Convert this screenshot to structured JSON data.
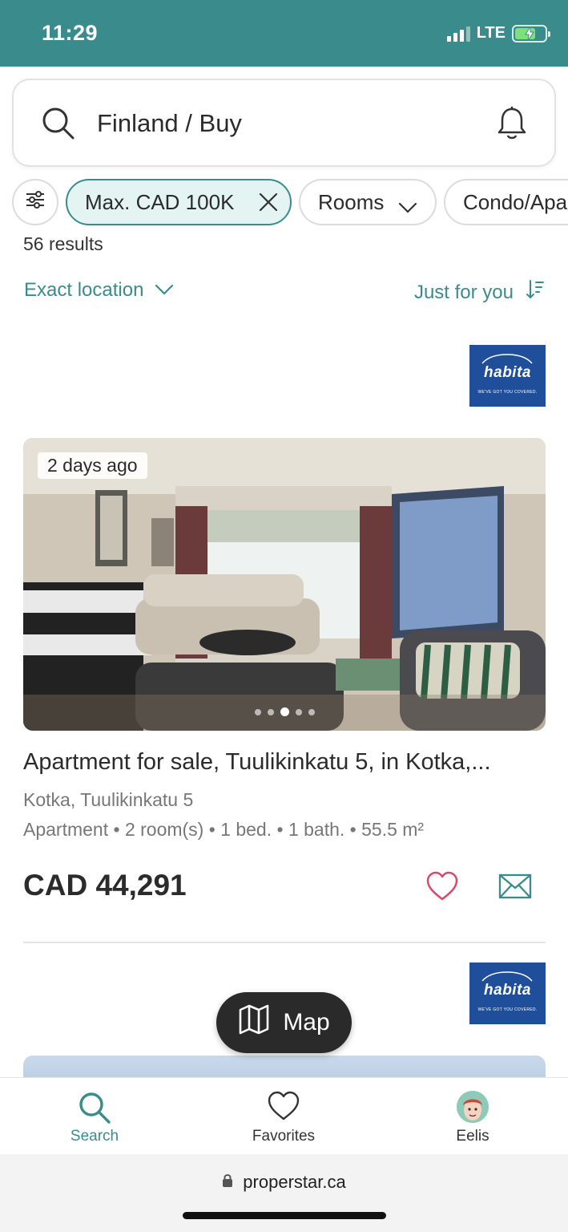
{
  "status_bar": {
    "time": "11:29",
    "network": "LTE",
    "battery_color": "#7ee07a"
  },
  "search": {
    "query": "Finland / Buy",
    "icon": "search-icon",
    "alert_icon": "bell-icon"
  },
  "filters": {
    "settings_icon": "sliders-icon",
    "chips": [
      {
        "label": "Max. CAD 100K",
        "active": true,
        "icon": "close-icon"
      },
      {
        "label": "Rooms",
        "active": false,
        "icon": "chevron-down-icon"
      },
      {
        "label": "Condo/Apa",
        "active": false
      }
    ]
  },
  "results": {
    "count_text": "56 results"
  },
  "location_filter": {
    "label": "Exact location"
  },
  "sort": {
    "label": "Just for you"
  },
  "agency": {
    "name": "habita",
    "tagline": "WE'VE GOT YOU COVERED."
  },
  "listing": {
    "badge": "2 days ago",
    "title": "Apartment for sale, Tuulikinkatu 5, in Kotka,...",
    "address": "Kotka, Tuulikinkatu 5",
    "specs": "Apartment • 2 room(s) • 1 bed. • 1 bath. • 55.5 m²",
    "price": "CAD 44,291",
    "photo_count": 5,
    "active_photo_index": 2
  },
  "map_button": {
    "label": "Map"
  },
  "tabs": [
    {
      "label": "Search",
      "active": true
    },
    {
      "label": "Favorites",
      "active": false
    },
    {
      "label": "Eelis",
      "active": false
    }
  ],
  "browser": {
    "url": "properstar.ca"
  },
  "colors": {
    "accent": "#3a8c8c",
    "status_bar": "#3a8c8c",
    "agency": "#1f4f9a",
    "favorite": "#d94a6a"
  }
}
